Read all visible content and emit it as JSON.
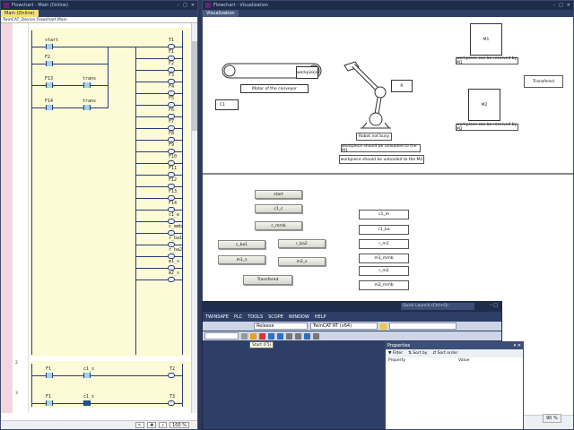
{
  "left_window": {
    "title": "Flowchart - Main (Online)",
    "tab": "Main (Online)",
    "path": "TwinCAT_Device.Flowchart.Main",
    "zoom": "100 %"
  },
  "ladder": {
    "contacts": [
      "start",
      "F2",
      "F13",
      "trans",
      "F14",
      "trans"
    ],
    "coils": [
      "T1",
      "F1",
      "F2",
      "F3",
      "F4",
      "F5",
      "F6",
      "F7",
      "F8",
      "F9",
      "F10",
      "F11",
      "F12",
      "F13",
      "F14",
      "c1_e",
      "c_mmb",
      "r_ba1",
      "r_ba2",
      "m1_s",
      "m2_s"
    ],
    "network2": {
      "number": "2",
      "contact1": "F1",
      "contact2": "c1_s",
      "coil": "T2"
    },
    "network3": {
      "number": "3",
      "contact1": "F1",
      "contact2": "c1_s",
      "coil": "T3"
    }
  },
  "right_window": {
    "title": "Flowchart - Visualization",
    "tab": "Visualization"
  },
  "visualization": {
    "m1_label": "M1",
    "m2_label": "M2",
    "workpiece": "workpiece",
    "conveyor_label": "Motor of the conveyor",
    "c1_label": "C1",
    "r_label": "R",
    "robot_status": "Robot not busy",
    "unload_m1": "workpiece should be unloaded to the M1",
    "unload_m2": "workpiece should be unloaded to the M2",
    "received_m1": "workpiece can be received by M1",
    "received_m2": "workpiece can be received by M2",
    "transfered": "Transfered",
    "buttons": {
      "start": "start",
      "c1_c": "c1_c",
      "c_mmb": "c_mmb",
      "c_ba1": "c_ba1",
      "r_ba2": "r_ba2",
      "m1_s": "m1_s",
      "m2_s": "m2_s",
      "transfered": "Transfered"
    },
    "lamps": [
      "c1_m",
      "c1_ba",
      "r_m1",
      "m1_mmb",
      "r_m2",
      "m2_mmb"
    ]
  },
  "vs": {
    "quick_launch": "Quick Launch (Ctrl+Q)",
    "menus": [
      "TWINSAFE",
      "PLC",
      "TOOLS",
      "SCOPE",
      "WINDOW",
      "HELP"
    ],
    "config": "Release",
    "platform": "TwinCAT RT (x64)",
    "tooltip": "Start (F5)"
  },
  "properties": {
    "title": "Properties",
    "filter": "Filter",
    "sort_by": "Sort by",
    "sort_order": "Sort order",
    "col_property": "Property",
    "col_value": "Value"
  },
  "visu_zoom": "90 %"
}
